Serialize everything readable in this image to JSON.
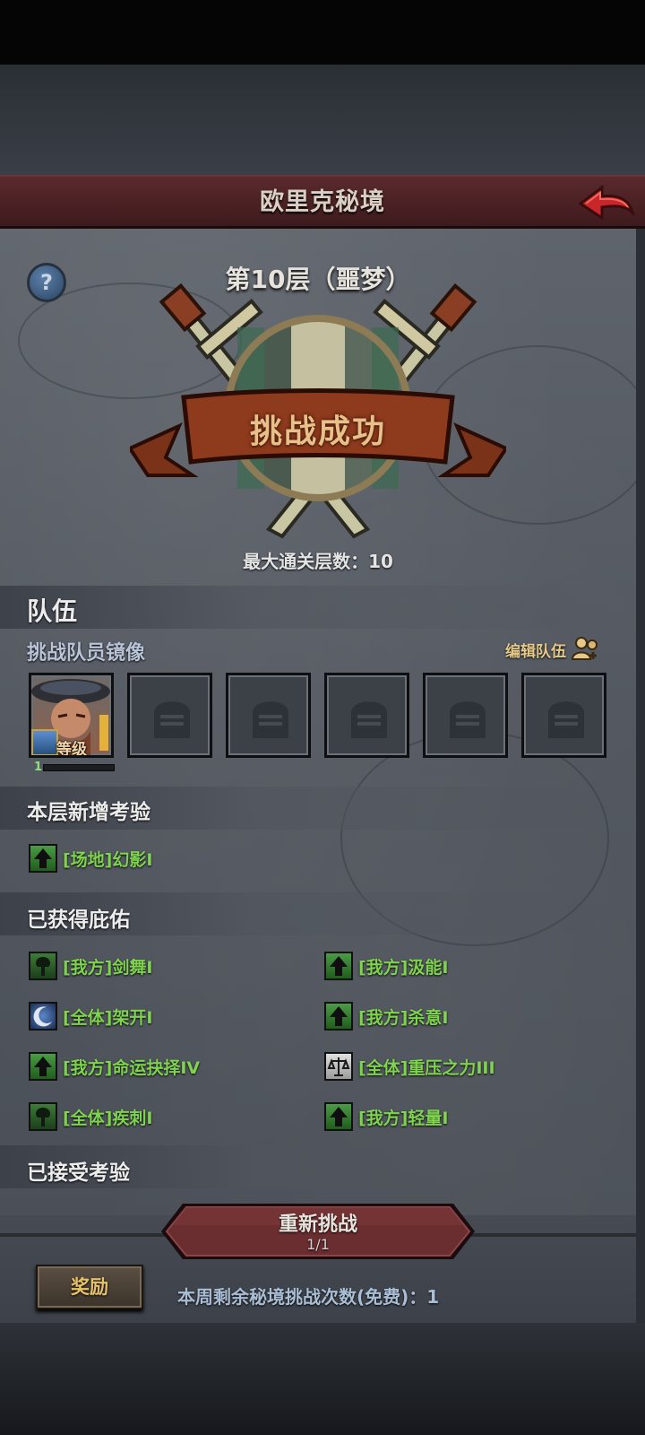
{
  "header": {
    "title": "欧里克秘境"
  },
  "floor": {
    "title": "第10层（噩梦）",
    "banner": "挑战成功",
    "max_floor": "最大通关层数：10"
  },
  "team": {
    "section_title": "队伍",
    "subtitle": "挑战队员镜像",
    "edit_label": "编辑队伍",
    "hero": {
      "level_label": "等级150",
      "star": "1",
      "exp_fraction": 0.0
    }
  },
  "new_trials": {
    "section_title": "本层新增考验",
    "items": [
      {
        "icon": "arrow-up-icon",
        "label": "[场地]幻影I"
      }
    ]
  },
  "blessings": {
    "section_title": "已获得庇佑",
    "left": [
      {
        "icon": "tree-icon",
        "label": "[我方]剑舞I"
      },
      {
        "icon": "moon-icon",
        "label": "[全体]架开I"
      },
      {
        "icon": "arrow-up-icon",
        "label": "[我方]命运抉择IV"
      },
      {
        "icon": "tree-icon",
        "label": "[全体]疾刺I"
      }
    ],
    "right": [
      {
        "icon": "arrow-up-icon",
        "label": "[我方]汲能I"
      },
      {
        "icon": "arrow-up-icon",
        "label": "[我方]杀意I"
      },
      {
        "icon": "scale-icon",
        "label": "[全体]重压之力III"
      },
      {
        "icon": "arrow-up-icon",
        "label": "[我方]轻量I"
      }
    ]
  },
  "accepted_trials": {
    "section_title": "已接受考验"
  },
  "footer": {
    "retry_label": "重新挑战",
    "retry_count": "1/1",
    "reward_label": "奖励",
    "weekly_text": "本周剩余秘境挑战次数(免费)：1"
  },
  "colors": {
    "buff_text": "#7fd34f",
    "header_bg": "#5a2a2d",
    "gold": "#e7c26a"
  }
}
